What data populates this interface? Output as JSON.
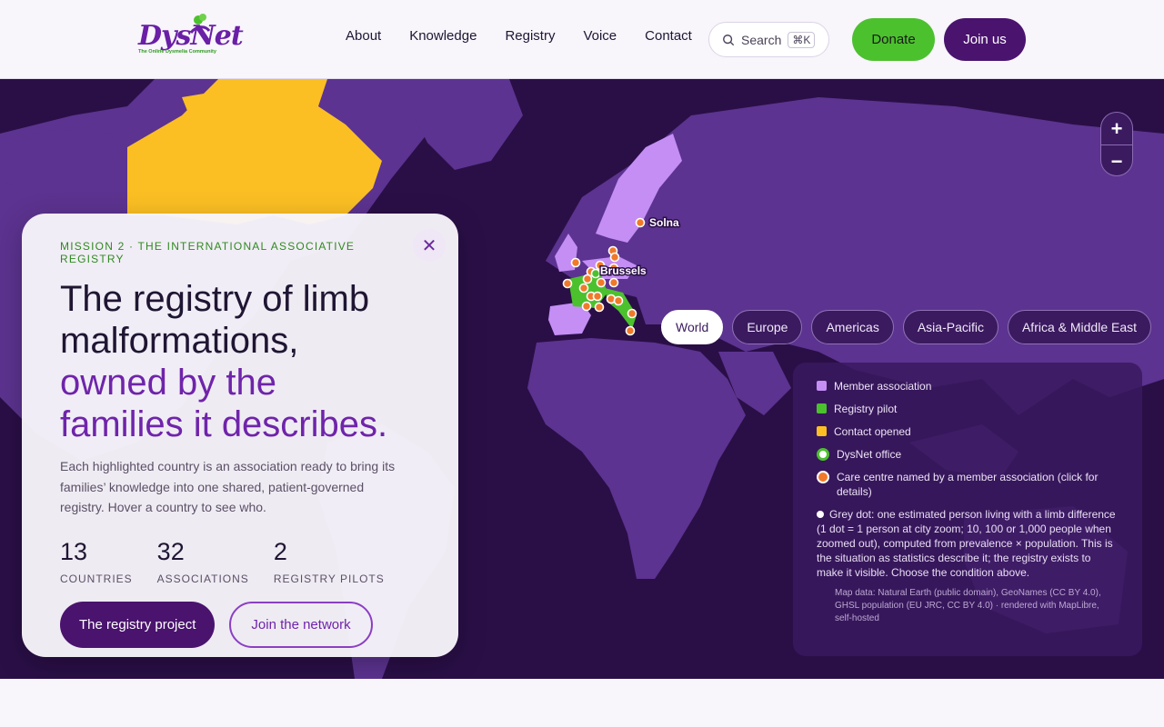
{
  "header": {
    "logo_text": "DysNet",
    "logo_tagline": "The Online Dysmelia Community",
    "nav": [
      "About",
      "Knowledge",
      "Registry",
      "Voice",
      "Contact"
    ],
    "search_label": "Search",
    "search_shortcut": "⌘K",
    "donate_label": "Donate",
    "join_label": "Join us"
  },
  "map": {
    "zoom_in": "+",
    "zoom_out": "−",
    "city_labels": [
      "Solna",
      "Brussels"
    ],
    "regions": [
      "World",
      "Europe",
      "Americas",
      "Asia-Pacific",
      "Africa & Middle East"
    ],
    "active_region": "World",
    "colors": {
      "ocean": "#2a0f47",
      "land": "#5c3390",
      "member_association": "#c48ef5",
      "registry_pilot": "#4cc12e",
      "contact_opened": "#fbbf24",
      "care_centre": "#f07a2a"
    }
  },
  "legend": {
    "items": [
      {
        "label": "Member association",
        "color": "#c48ef5"
      },
      {
        "label": "Registry pilot",
        "color": "#4cc12e"
      },
      {
        "label": "Contact opened",
        "color": "#fbbf24"
      },
      {
        "label": "DysNet office",
        "color": "#4cc12e"
      },
      {
        "label": "Care centre named by a member association (click for details)",
        "color": "#f07a2a"
      }
    ],
    "grey_dot_note": "Grey dot: one estimated person living with a limb difference (1 dot = 1 person at city zoom; 10, 100 or 1,000 people when zoomed out), computed from prevalence × population. This is the situation as statistics describe it; the registry exists to make it visible. Choose the condition above.",
    "attribution": "Map data: Natural Earth (public domain), GeoNames (CC BY 4.0), GHSL population (EU JRC, CC BY 4.0) · rendered with MapLibre, self-hosted"
  },
  "card": {
    "eyebrow": "MISSION 2 · THE INTERNATIONAL ASSOCIATIVE REGISTRY",
    "close": "✕",
    "title_line1": "The registry of limb",
    "title_line2": "malformations,",
    "title_accent1": "owned by the",
    "title_accent2": "families it describes.",
    "description": "Each highlighted country is an association ready to bring its families’ knowledge into one shared, patient-governed registry. Hover a country to see who.",
    "stats": [
      {
        "value": "13",
        "label": "COUNTRIES"
      },
      {
        "value": "32",
        "label": "ASSOCIATIONS"
      },
      {
        "value": "2",
        "label": "REGISTRY PILOTS"
      }
    ],
    "primary_cta": "The registry project",
    "secondary_cta": "Join the network"
  }
}
